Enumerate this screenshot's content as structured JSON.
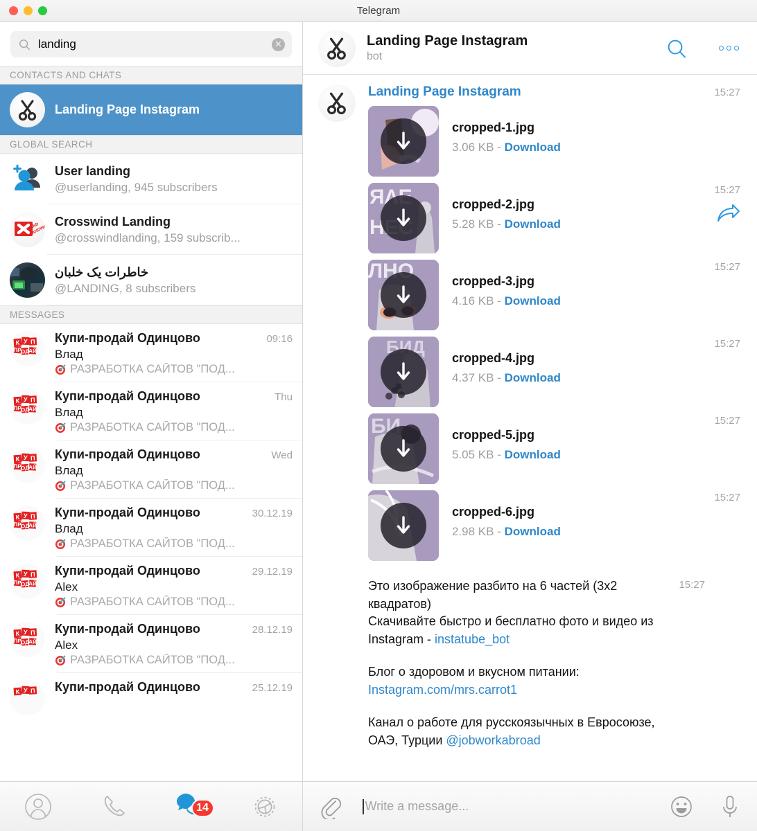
{
  "window": {
    "title": "Telegram",
    "controls": [
      "close",
      "minimize",
      "zoom"
    ]
  },
  "search": {
    "value": "landing",
    "placeholder": "Search",
    "icon": "search-icon",
    "clear_icon": "clear-icon"
  },
  "sidebar": {
    "sections": [
      {
        "id": "contacts",
        "label": "CONTACTS AND CHATS"
      },
      {
        "id": "global",
        "label": "GLOBAL SEARCH"
      },
      {
        "id": "messages",
        "label": "MESSAGES"
      }
    ],
    "contacts_and_chats": [
      {
        "title": "Landing Page Instagram",
        "selected": true,
        "avatar": "scissors-avatar"
      }
    ],
    "global_search": [
      {
        "title": "User landing",
        "subtitle": "@userlanding, 945 subscribers",
        "avatar": "users-avatar"
      },
      {
        "title": "Crosswind Landing",
        "subtitle": "@crosswindlanding, 159 subscrib...",
        "avatar": "crosswind-avatar"
      },
      {
        "title": "خاطرات يک خلبان",
        "subtitle": "@LANDING, 8 subscribers",
        "avatar": "cockpit-avatar",
        "rtl": true
      }
    ],
    "messages": [
      {
        "name": "Купи-продай Одинцово",
        "time": "09:16",
        "from": "Влад",
        "preview": "РАЗРАБОТКА САЙТОВ \"ПОД...",
        "emoji": "dart-emoji"
      },
      {
        "name": "Купи-продай Одинцово",
        "time": "Thu",
        "from": "Влад",
        "preview": "РАЗРАБОТКА САЙТОВ \"ПОД...",
        "emoji": "dart-emoji"
      },
      {
        "name": "Купи-продай Одинцово",
        "time": "Wed",
        "from": "Влад",
        "preview": "РАЗРАБОТКА САЙТОВ \"ПОД...",
        "emoji": "dart-emoji"
      },
      {
        "name": "Купи-продай Одинцово",
        "time": "30.12.19",
        "from": "Влад",
        "preview": "РАЗРАБОТКА САЙТОВ \"ПОД...",
        "emoji": "dart-emoji"
      },
      {
        "name": "Купи-продай Одинцово",
        "time": "29.12.19",
        "from": "Alex",
        "preview": "РАЗРАБОТКА САЙТОВ \"ПОД...",
        "emoji": "dart-emoji"
      },
      {
        "name": "Купи-продай Одинцово",
        "time": "28.12.19",
        "from": "Alex",
        "preview": "РАЗРАБОТКА САЙТОВ \"ПОД...",
        "emoji": "dart-emoji"
      },
      {
        "name": "Купи-продай Одинцово",
        "time": "25.12.19",
        "from": "",
        "preview": "",
        "emoji": "dart-emoji"
      }
    ]
  },
  "bottom_nav": [
    {
      "id": "contacts",
      "icon": "person-icon",
      "badge": null
    },
    {
      "id": "calls",
      "icon": "phone-icon",
      "badge": null
    },
    {
      "id": "chats",
      "icon": "chat-bubbles-icon",
      "badge": "14"
    },
    {
      "id": "settings",
      "icon": "gear-icon",
      "badge": null
    }
  ],
  "chat": {
    "header": {
      "title": "Landing Page Instagram",
      "subtitle": "bot",
      "avatar": "scissors-avatar",
      "search_icon": "search-icon",
      "menu_icon": "more-options-icon"
    },
    "group": {
      "sender": "Landing Page Instagram",
      "avatar": "scissors-avatar",
      "time": "15:27"
    },
    "files": [
      {
        "name": "cropped-1.jpg",
        "size": "3.06 KB",
        "separator": "-",
        "action": "Download",
        "time": "15:27",
        "show_time": false,
        "forward": false
      },
      {
        "name": "cropped-2.jpg",
        "size": "5.28 KB",
        "separator": "-",
        "action": "Download",
        "time": "15:27",
        "show_time": true,
        "forward": true
      },
      {
        "name": "cropped-3.jpg",
        "size": "4.16 KB",
        "separator": "-",
        "action": "Download",
        "time": "15:27",
        "show_time": true,
        "forward": false
      },
      {
        "name": "cropped-4.jpg",
        "size": "4.37 KB",
        "separator": "-",
        "action": "Download",
        "time": "15:27",
        "show_time": true,
        "forward": false
      },
      {
        "name": "cropped-5.jpg",
        "size": "5.05 KB",
        "separator": "-",
        "action": "Download",
        "time": "15:27",
        "show_time": true,
        "forward": false
      },
      {
        "name": "cropped-6.jpg",
        "size": "2.98 KB",
        "separator": "-",
        "action": "Download",
        "time": "15:27",
        "show_time": true,
        "forward": false
      }
    ],
    "text_message": {
      "time": "15:27",
      "line1": "Это изображение разбито на 6 частей (3x2 квадратов)",
      "line2_prefix": "Скачивайте быстро и бесплатно фото и видео из Instagram - ",
      "line2_link": "instatube_bot",
      "line3": "Блог о здоровом и вкусном питании:",
      "line3_link": "Instagram.com/mrs.carrot1",
      "line4_prefix": "Канал о работе для русскоязычных в Евросоюзе, ОАЭ, Турции ",
      "line4_link": "@jobworkabroad"
    }
  },
  "composer": {
    "attach_icon": "paperclip-icon",
    "placeholder": "Write a message...",
    "value": "",
    "emoji_icon": "smiley-icon",
    "mic_icon": "microphone-icon"
  },
  "colors": {
    "accent": "#2f87c9",
    "selection": "#4d92c8",
    "badge": "#f5392e",
    "thumb_bg": "#a99bbd",
    "muted_text": "#a0a0a0"
  }
}
